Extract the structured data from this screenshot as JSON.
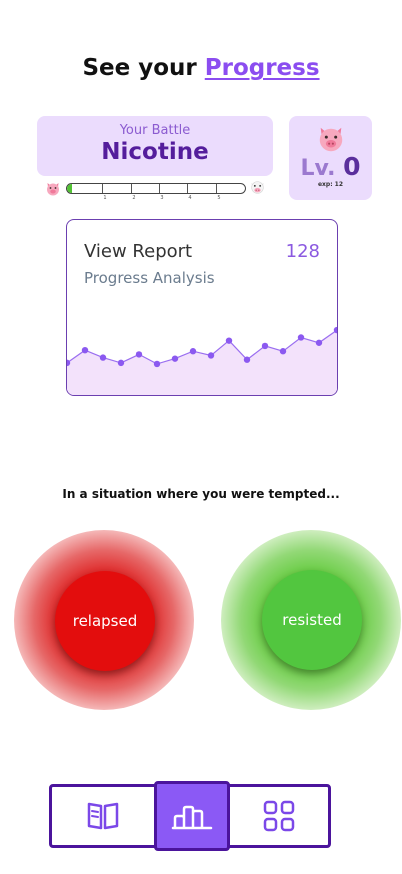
{
  "header": {
    "prefix": "See your ",
    "accent": "Progress"
  },
  "battle": {
    "caption": "Your Battle",
    "name": "Nicotine"
  },
  "level": {
    "prefix": "Lv. ",
    "value": "0",
    "exp": "exp: 12"
  },
  "progress": {
    "value_fraction": 0.03,
    "ticks": [
      "1",
      "2",
      "3",
      "4",
      "5"
    ]
  },
  "report": {
    "title": "View Report",
    "count": "128",
    "subtitle": "Progress Analysis"
  },
  "chart_data": {
    "type": "area",
    "values": [
      2,
      14,
      7,
      2,
      10,
      1,
      6,
      13,
      9,
      23,
      5,
      18,
      13,
      26,
      21,
      33
    ]
  },
  "prompt": "In a situation where you were tempted...",
  "actions": {
    "relapsed": "relapsed",
    "resisted": "resisted"
  },
  "nav": {
    "items": [
      "journal-icon",
      "stats-icon",
      "grid-icon"
    ],
    "active": 1
  },
  "colors": {
    "accent": "#8b4df0",
    "card_bg": "#ebdcfd",
    "relapsed": "#e30d0d",
    "resisted": "#52c63f",
    "nav_border": "#4b149c",
    "nav_active": "#8b59f5"
  }
}
